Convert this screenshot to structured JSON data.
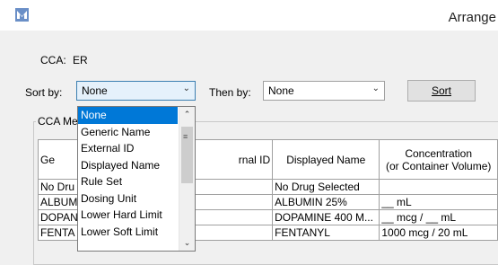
{
  "window": {
    "title": "Arrange",
    "icon": "app-logo-icon",
    "accent_color": "#3c7fb1"
  },
  "cca": {
    "label": "CCA:",
    "value": "ER"
  },
  "sort": {
    "label": "Sort by:",
    "value": "None",
    "then_label": "Then by:",
    "then_value": "None",
    "button_label": "Sort"
  },
  "group": {
    "label": "CCA Me"
  },
  "dropdown": {
    "items": [
      "None",
      "Generic Name",
      "External ID",
      "Displayed Name",
      "Rule Set",
      "Dosing Unit",
      "Lower Hard Limit",
      "Lower Soft Limit"
    ],
    "selected_index": 0,
    "selected_color": "#0078d7"
  },
  "table": {
    "headers": [
      "Ge",
      "rnal ID",
      "Displayed Name",
      "Concentration",
      "(or Container Volume)"
    ],
    "rows": [
      [
        "No Dru",
        "",
        "No Drug Selected",
        ""
      ],
      [
        "ALBUM",
        "",
        "ALBUMIN 25%",
        "__ mL"
      ],
      [
        "DOPAN",
        "",
        "DOPAMINE 400 M...",
        "__ mcg / __ mL"
      ],
      [
        "FENTA",
        "",
        "FENTANYL",
        "1000 mcg / 20 mL"
      ]
    ]
  }
}
